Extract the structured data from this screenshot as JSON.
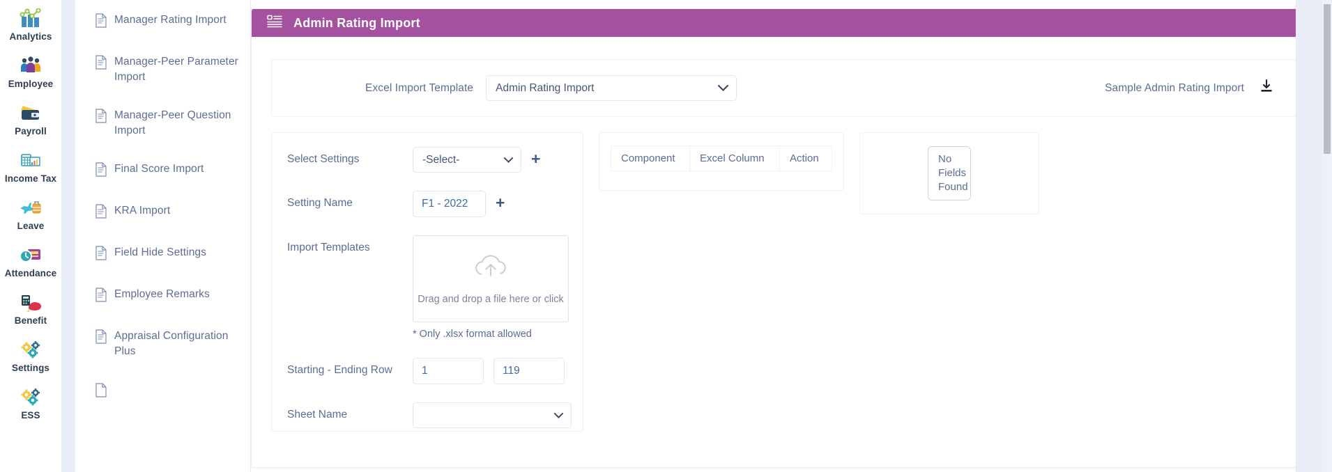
{
  "rail": {
    "items": [
      {
        "label": "Analytics",
        "icon": "analytics-icon"
      },
      {
        "label": "Employee",
        "icon": "employee-icon"
      },
      {
        "label": "Payroll",
        "icon": "payroll-icon"
      },
      {
        "label": "Income Tax",
        "icon": "income-tax-icon"
      },
      {
        "label": "Leave",
        "icon": "leave-icon"
      },
      {
        "label": "Attendance",
        "icon": "attendance-icon"
      },
      {
        "label": "Benefit",
        "icon": "benefit-icon"
      },
      {
        "label": "Settings",
        "icon": "settings-icon"
      },
      {
        "label": "ESS",
        "icon": "ess-icon"
      }
    ]
  },
  "submenu": {
    "items": [
      {
        "label": "Manager Rating Import"
      },
      {
        "label": "Manager-Peer Parameter Import"
      },
      {
        "label": "Manager-Peer Question Import"
      },
      {
        "label": "Final Score Import"
      },
      {
        "label": "KRA Import"
      },
      {
        "label": "Field Hide Settings"
      },
      {
        "label": "Employee Remarks"
      },
      {
        "label": "Appraisal Configuration Plus"
      }
    ]
  },
  "panel": {
    "title": "Admin Rating Import",
    "header_icon": "list-settings-icon",
    "header_color": "#a4519f"
  },
  "template_section": {
    "label": "Excel Import Template",
    "selected": "Admin Rating Import",
    "options": [
      "Admin Rating Import"
    ],
    "sample_label": "Sample Admin Rating Import",
    "download_icon": "download-icon"
  },
  "form": {
    "select_settings": {
      "label": "Select Settings",
      "value": "-Select-",
      "options": [
        "-Select-"
      ],
      "add_label": "+"
    },
    "setting_name": {
      "label": "Setting Name",
      "value": "F1 - 2022",
      "add_label": "+"
    },
    "import_templates": {
      "label": "Import Templates",
      "drop_text": "Drag and drop a file here or click",
      "upload_icon": "cloud-upload-icon",
      "note": "* Only .xlsx format allowed"
    },
    "row_range": {
      "label": "Starting - Ending Row",
      "start": "1",
      "end": "119"
    },
    "sheet_name": {
      "label": "Sheet Name",
      "value": "",
      "options": [
        ""
      ]
    }
  },
  "mapping_table": {
    "columns": [
      "Component",
      "Excel Column",
      "Action"
    ],
    "rows": []
  },
  "fields_panel": {
    "empty_text": "No Fields Found"
  }
}
